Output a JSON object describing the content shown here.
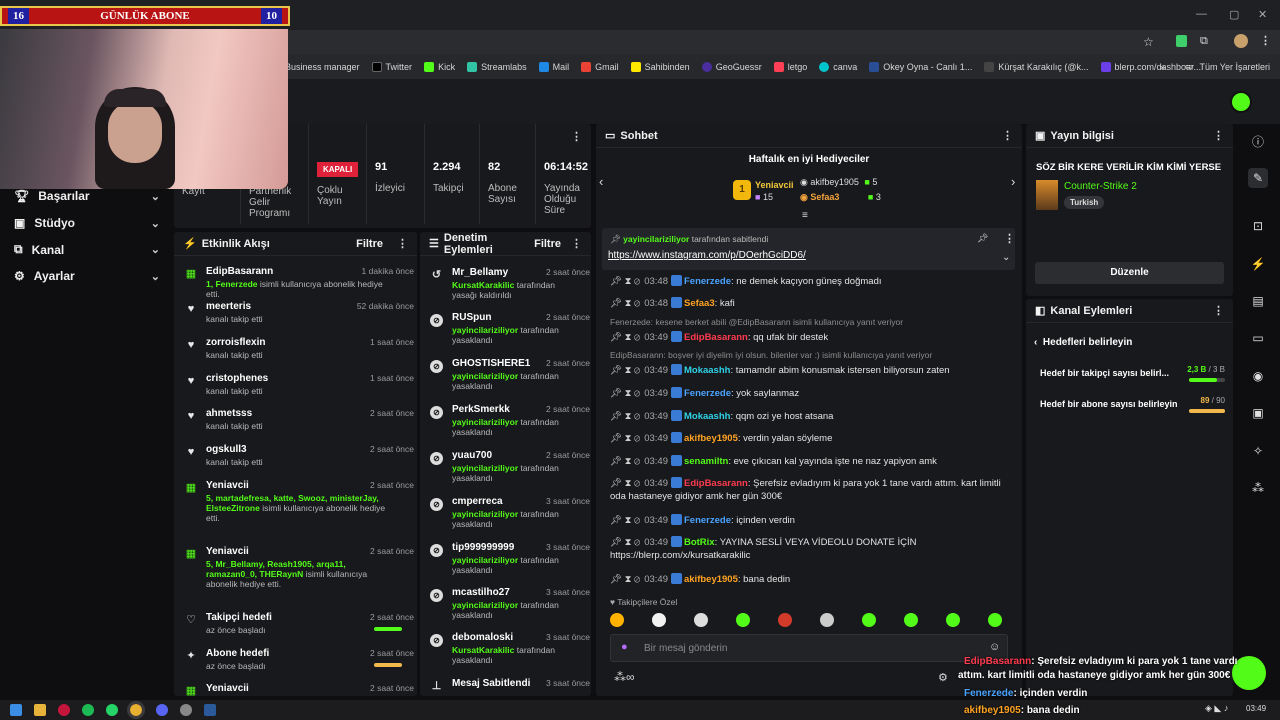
{
  "overlay": {
    "sub_left": "16",
    "sub_title": "GÜNLÜK ABONE",
    "sub_right": "10",
    "chat_lines": [
      {
        "user": "EdipBasarann",
        "text": ": Şerefsiz evladıyım ki para yok 1 tane vardı"
      },
      {
        "user": "",
        "text": "attım. kart limitli oda hastaneye gidiyor amk her gün 300€"
      },
      {
        "user": "Fenerzede",
        "text": ": içinden verdin"
      },
      {
        "user": "akifbey1905",
        "text": ": bana dedin"
      }
    ]
  },
  "bookmarks": [
    "Business manager",
    "Twitter",
    "Kick",
    "Streamlabs",
    "Mail",
    "Gmail",
    "Sahibinden",
    "GeoGuessr",
    "letgo",
    "canva",
    "Okey Oyna - Canlı 1...",
    "Kürşat Karakılıç (@k...",
    "blerp.com/dashboar..."
  ],
  "bookmarks_right": "Tüm Yer İşaretleri",
  "nav": [
    {
      "label": "Başarılar",
      "icon": "trophy-icon"
    },
    {
      "label": "Stüdyo",
      "icon": "studio-icon"
    },
    {
      "label": "Kanal",
      "icon": "channel-icon"
    },
    {
      "label": "Ayarlar",
      "icon": "gear-icon"
    }
  ],
  "stats": {
    "partial1": "Kayıt",
    "partial2": "Partnerlik Gelir Programı",
    "status_badge": "KAPALI",
    "status_label": "Çoklu Yayın",
    "viewers_value": "91",
    "viewers_label": "İzleyici",
    "followers_value": "2.294",
    "followers_label": "Takipçi",
    "subs_value": "82",
    "subs_label": "Abone Sayısı",
    "uptime_value": "06:14:52",
    "uptime_label": "Yayında Olduğu Süre"
  },
  "activity": {
    "title": "Etkinlik Akışı",
    "filter": "Filtre",
    "items": [
      {
        "name": "EdipBasarann",
        "time": "1 dakika önce",
        "hl": "1, Fenerzede",
        "sub": " isimli kullanıcıya abonelik hediye etti."
      },
      {
        "name": "meerteris",
        "time": "52 dakika önce",
        "hl": "",
        "sub": "kanalı takip etti"
      },
      {
        "name": "zorroisflexin",
        "time": "1 saat önce",
        "hl": "",
        "sub": "kanalı takip etti"
      },
      {
        "name": "cristophenes",
        "time": "1 saat önce",
        "hl": "",
        "sub": "kanalı takip etti"
      },
      {
        "name": "ahmetsss",
        "time": "2 saat önce",
        "hl": "",
        "sub": "kanalı takip etti"
      },
      {
        "name": "ogskull3",
        "time": "2 saat önce",
        "hl": "",
        "sub": "kanalı takip etti"
      },
      {
        "name": "Yeniavcii",
        "time": "2 saat önce",
        "hl": "5, martadefresa, katte, Swooz, ministerJay, ElsteeZitrone",
        "sub": " isimli kullanıcıya abonelik hediye etti."
      },
      {
        "name": "Yeniavcii",
        "time": "2 saat önce",
        "hl": "5, Mr_Bellamy, Reash1905, arqa11, ramazan0_0, THERaynN",
        "sub": " isimli kullanıcıya abonelik hediye etti."
      },
      {
        "name": "Takipçi hedefi",
        "time": "2 saat önce",
        "hl": "",
        "sub": "az önce başladı"
      },
      {
        "name": "Abone hedefi",
        "time": "2 saat önce",
        "hl": "",
        "sub": "az önce başladı"
      },
      {
        "name": "Yeniavcii",
        "time": "2 saat önce",
        "hl": "",
        "sub": ""
      }
    ]
  },
  "moderation": {
    "title": "Denetim Eylemleri",
    "filter": "Filtre",
    "items": [
      {
        "name": "Mr_Bellamy",
        "time": "2 saat önce",
        "by": "KursatKarakilic",
        "sub": " tarafından yasağı kaldırıldı"
      },
      {
        "name": "RUSpun",
        "time": "2 saat önce",
        "by": "yayincilariziliyor",
        "sub": " tarafından yasaklandı"
      },
      {
        "name": "GHOSTISHERE1",
        "time": "2 saat önce",
        "by": "yayincilariziliyor",
        "sub": " tarafından yasaklandı"
      },
      {
        "name": "PerkSmerkk",
        "time": "2 saat önce",
        "by": "yayincilariziliyor",
        "sub": " tarafından yasaklandı"
      },
      {
        "name": "yuau700",
        "time": "2 saat önce",
        "by": "yayincilariziliyor",
        "sub": " tarafından yasaklandı"
      },
      {
        "name": "cmperreca",
        "time": "3 saat önce",
        "by": "yayincilariziliyor",
        "sub": " tarafından yasaklandı"
      },
      {
        "name": "tip999999999",
        "time": "3 saat önce",
        "by": "yayincilariziliyor",
        "sub": " tarafından yasaklandı"
      },
      {
        "name": "mcastilho27",
        "time": "3 saat önce",
        "by": "yayincilariziliyor",
        "sub": " tarafından yasaklandı"
      },
      {
        "name": "debomaloski",
        "time": "3 saat önce",
        "by": "KursatKarakilic",
        "sub": " tarafından yasaklandı"
      },
      {
        "name": "Mesaj Sabitlendi",
        "time": "3 saat önce",
        "by": "",
        "sub": ""
      }
    ]
  },
  "chat": {
    "title": "Sohbet",
    "gifters_title": "Haftalık en iyi Hediyeciler",
    "top_gifter": "Yeniavcii",
    "top_gifter_count": "15",
    "gifter2": "akifbey1905",
    "gifter2_count": "5",
    "gifter3": "Sefaa3",
    "gifter3_count": "3",
    "pinned_by": "yayincilariziliyor",
    "pinned_by_suffix": "tarafından sabitlendi",
    "pinned_link": "https://www.instagram.com/p/DOerhGciDD6/",
    "messages": [
      {
        "time": "03:48",
        "user": "Fenerzede",
        "cls": "u-blue",
        "text": ": ne demek kaçıyon güneş doğmadı"
      },
      {
        "time": "03:48",
        "user": "Sefaa3",
        "cls": "u-orange",
        "text": ": kafi"
      },
      {
        "time": "03:49",
        "user": "EdipBasarann",
        "cls": "u-red",
        "text": ": qq ufak bir destek"
      },
      {
        "time": "03:49",
        "user": "Mokaashh",
        "cls": "u-cyan",
        "text": ": tamamdır abim konusmak istersen biliyorsun zaten"
      },
      {
        "time": "03:49",
        "user": "Fenerzede",
        "cls": "u-blue",
        "text": ": yok saylanmaz"
      },
      {
        "time": "03:49",
        "user": "Mokaashh",
        "cls": "u-cyan",
        "text": ": qqm ozi ye host atsana"
      },
      {
        "time": "03:49",
        "user": "akifbey1905",
        "cls": "u-orange",
        "text": ": verdin yalan söyleme"
      },
      {
        "time": "03:49",
        "user": "senamiltn",
        "cls": "u-green",
        "text": ": eve çıkıcan kal yayında işte ne naz yapiyon amk"
      },
      {
        "time": "03:49",
        "user": "EdipBasarann",
        "cls": "u-red",
        "text": ": Şerefsiz evladıyım ki para yok 1 tane vardı attım. kart limitli oda hastaneye gidiyor amk her gün 300€"
      },
      {
        "time": "03:49",
        "user": "Fenerzede",
        "cls": "u-blue",
        "text": ": içinden verdin"
      },
      {
        "time": "03:49",
        "user": "BotRix",
        "cls": "u-green",
        "text": ": YAYINA SESLİ VEYA VİDEOLU DONATE İÇİN https://blerp.com/x/kursatkarakilic"
      },
      {
        "time": "03:49",
        "user": "akifbey1905",
        "cls": "u-orange",
        "text": ": bana dedin"
      }
    ],
    "reply1": "Fenerzede: kesene berket abili @EdipBasarann isimli kullanıcıya yanıt veriyor",
    "reply2": "EdipBasarann: boşver iyi diyelim iyi olsun. bilenler var :) isimli kullanıcıya yanıt veriyor",
    "followers_only": "Takipçilere Özel",
    "input_placeholder": "Bir mesaj gönderin"
  },
  "stream_info": {
    "title": "Yayın bilgisi",
    "stream_title": "SÖZ BİR KERE VERİLİR KİM KİMİ YERSE",
    "category": "Counter-Strike 2",
    "tag": "Turkish",
    "edit": "Düzenle"
  },
  "channel_actions": {
    "title": "Kanal Eylemleri",
    "back_label": "Hedefleri belirleyin",
    "goals": [
      {
        "label": "Hedef bir takipçi sayısı belirl...",
        "value": "2,3 B",
        "target": "3 B",
        "progress": 0.77
      },
      {
        "label": "Hedef bir abone sayısı belirleyin",
        "value": "89",
        "target": "90",
        "progress": 0.99
      }
    ]
  },
  "taskbar_time": "03:49",
  "colors": {
    "accent": "#53fc18",
    "danger": "#e0213a",
    "bg": "#0e0e10",
    "panel": "#18191c"
  }
}
